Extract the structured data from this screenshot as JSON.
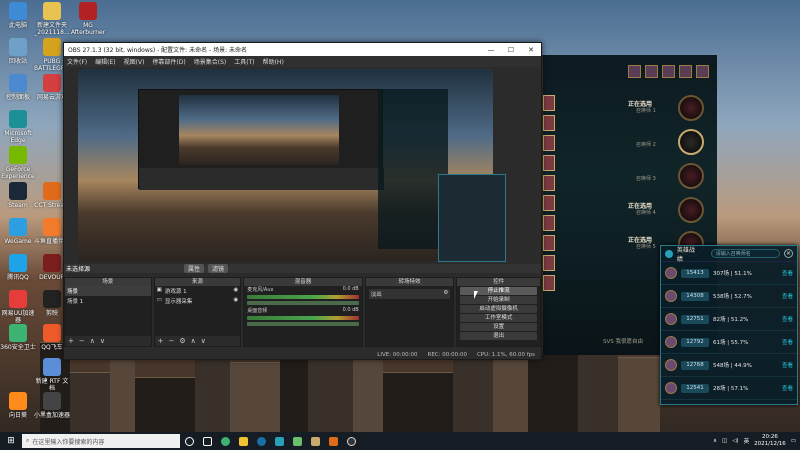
{
  "desktop": {
    "icons": [
      {
        "label": "此电脑",
        "color": "#3c8bd4"
      },
      {
        "label": "新建文件夹_2021118...",
        "color": "#e8c352"
      },
      {
        "label": "MG Afterburner",
        "color": "#b22222"
      },
      {
        "label": "回收站",
        "color": "#6fa0c8"
      },
      {
        "label": "PUBG BATTLEGR...",
        "color": "#d6a31e"
      },
      {
        "label": "控制面板",
        "color": "#4c8ad0"
      },
      {
        "label": "网易云游戏",
        "color": "#d43f3f"
      },
      {
        "label": "Microsoft Edge",
        "color": "#1d8f96"
      },
      {
        "label": "GeForce Experience",
        "color": "#76b900"
      },
      {
        "label": "Steam",
        "color": "#1b2838"
      },
      {
        "label": "CCT Stream",
        "color": "#e06b1a"
      },
      {
        "label": "WeGame",
        "color": "#2d9fe0"
      },
      {
        "label": "斗鱼直播伴侣",
        "color": "#f27b2c"
      },
      {
        "label": "腾讯QQ",
        "color": "#1fa3e8"
      },
      {
        "label": "DEVOUR",
        "color": "#7a1e1e"
      },
      {
        "label": "网易UU加速器",
        "color": "#e63c3c"
      },
      {
        "label": "剪映",
        "color": "#222"
      },
      {
        "label": "360安全卫士",
        "color": "#3cb371"
      },
      {
        "label": "QQ飞车",
        "color": "#ef5a2a"
      },
      {
        "label": "新建 RTF 文档",
        "color": "#5b8ed6"
      },
      {
        "label": "向日葵",
        "color": "#ff8c1a"
      },
      {
        "label": "小黑盒加速器",
        "color": "#444"
      }
    ]
  },
  "obs": {
    "title": "OBS 27.1.3 (32 bit, windows) - 配置文件: 未命名 - 场景: 未命名",
    "window_controls": [
      "—",
      "☐",
      "✕"
    ],
    "menu": [
      "文件(F)",
      "编辑(E)",
      "视图(V)",
      "停靠部件(D)",
      "场景集合(S)",
      "工具(T)",
      "帮助(H)"
    ],
    "scene_bar": {
      "label": "未选择源",
      "props": "属性",
      "filters": "滤镜"
    },
    "docks": {
      "scenes": {
        "header": "场景",
        "items": [
          "场景",
          "场景 1"
        ]
      },
      "sources": {
        "header": "来源",
        "items": [
          "游戏源 1",
          "显示器采集"
        ]
      },
      "mixer": {
        "header": "混音器",
        "tracks": [
          {
            "name": "麦克风/Aux",
            "db": "0.0 dB"
          },
          {
            "name": "桌面音频",
            "db": "0.0 dB"
          }
        ]
      },
      "transitions": {
        "header": "转场特效",
        "value": "淡出",
        "duration_label": "时长",
        "duration": "300 ms"
      },
      "controls": {
        "header": "控件",
        "buttons": [
          "停止推流",
          "开始录制",
          "启动虚拟摄像机",
          "工作室模式",
          "设置",
          "退出"
        ]
      }
    },
    "status": {
      "live": "LIVE: 00:00:00",
      "rec": "REC: 00:00:00",
      "cpu": "CPU: 1.1%, 60.00 fps"
    }
  },
  "lol": {
    "picks": [
      {
        "t1": "正在选用",
        "t2": "召唤师 1"
      },
      {
        "t1": "",
        "t2": "召唤师 2"
      },
      {
        "t1": "",
        "t2": "召唤师 3"
      },
      {
        "t1": "正在选用",
        "t2": "召唤师 4"
      },
      {
        "t1": "正在选用",
        "t2": "召唤师 5"
      }
    ],
    "bottom": "SVS 我很愿自由"
  },
  "popup": {
    "title": "英雄战绩",
    "search_placeholder": "请输入召唤师名",
    "close": "×",
    "rows": [
      {
        "id": "15413",
        "stats": "307场 | 51.1%",
        "action": "查看"
      },
      {
        "id": "14308",
        "stats": "538场 | 52.7%",
        "action": "查看"
      },
      {
        "id": "12751",
        "stats": "82场 | 51.2%",
        "action": "查看"
      },
      {
        "id": "12792",
        "stats": "61场 | 55.7%",
        "action": "查看"
      },
      {
        "id": "12768",
        "stats": "548场 | 44.9%",
        "action": "查看"
      },
      {
        "id": "12541",
        "stats": "28场 | 57.1%",
        "action": "查看"
      }
    ]
  },
  "taskbar": {
    "search_placeholder": "在这里输入你要搜索的内容",
    "time": "20:26",
    "date": "2021/12/16",
    "lang": "英"
  }
}
